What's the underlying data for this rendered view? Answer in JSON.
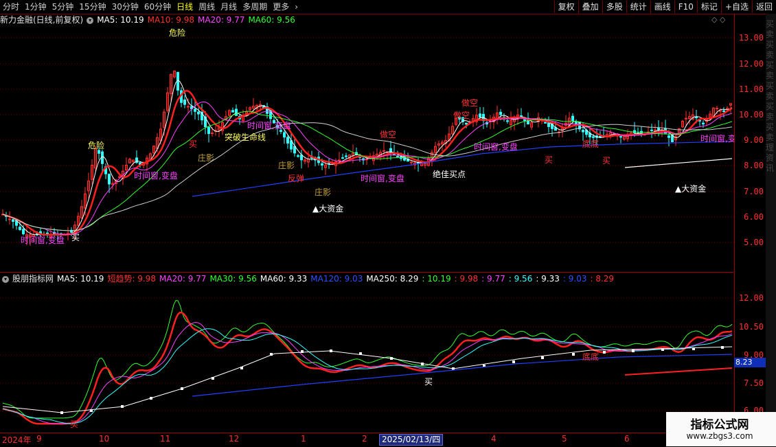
{
  "toolbar": {
    "periods": [
      "分时",
      "1分钟",
      "5分钟",
      "15分钟",
      "30分钟",
      "60分钟",
      "日线",
      "周线",
      "月线",
      "多周期",
      "更多"
    ],
    "active_period": "日线",
    "more_arrow": "›",
    "buttons": [
      "复权",
      "叠加",
      "多股",
      "统计",
      "画线",
      "F10",
      "标记",
      "+自选",
      "返回"
    ]
  },
  "main_panel": {
    "stock_title": "新力金融(日线,前复权)",
    "ma_labels": [
      {
        "text": "MA5: 10.19",
        "color": "#ffffff"
      },
      {
        "text": "MA10: 9.98",
        "color": "#ff3030"
      },
      {
        "text": "MA20: 9.77",
        "color": "#ff40ff"
      },
      {
        "text": "MA60: 9.56",
        "color": "#30ff30"
      }
    ],
    "top_icons": "◇  ◇",
    "y_ticks": [
      "13.00",
      "12.00",
      "11.00",
      "10.00",
      "9.00",
      "8.00",
      "7.00",
      "6.00",
      "5.00"
    ],
    "annotations": [
      "危险",
      "危险",
      "庄影",
      "庄影",
      "庄影",
      "反弹",
      "时间窗,变盘",
      "时间窗,变盘",
      "时间窗,变盘",
      "时间窗,变盘",
      "时间窗,变盘",
      "时间窗,变盘",
      "突破生命线",
      "做空",
      "做空",
      "做空",
      "买",
      "买",
      "买",
      "买",
      "绝佳买点",
      "▲大资金",
      "▲大资金",
      "底底"
    ],
    "right_strip_chars": "买卖买卖买卖买卖买卖买卖理资讯"
  },
  "indicator_panel": {
    "title": "股朋指标网",
    "ma_labels": [
      {
        "text": "MA5: 10.19",
        "color": "#ffffff"
      },
      {
        "text": "短趋势: 9.98",
        "color": "#ff3030"
      },
      {
        "text": "MA20: 9.77",
        "color": "#ff40ff"
      },
      {
        "text": "MA30: 9.56",
        "color": "#30ff30"
      },
      {
        "text": "MA60: 9.33",
        "color": "#ffffff"
      },
      {
        "text": "MA120: 9.03",
        "color": "#3050ff"
      },
      {
        "text": "MA250: 8.29",
        "color": "#ffffff"
      },
      {
        "text": ": 10.19",
        "color": "#30ff30"
      },
      {
        "text": ": 9.98",
        "color": "#ff3030"
      },
      {
        "text": ": 9.77",
        "color": "#ff40ff"
      },
      {
        "text": ": 9.56",
        "color": "#30ffff"
      },
      {
        "text": ": 9.33",
        "color": "#ffffff"
      },
      {
        "text": ": 9.03",
        "color": "#3050ff"
      },
      {
        "text": ": 8.29",
        "color": "#ff3030"
      }
    ],
    "y_ticks": [
      "12.00",
      "10.50",
      "9.00",
      "7.50",
      "6.00"
    ],
    "current_price_tag": "8.23",
    "annotations": [
      "买",
      "买",
      "底底"
    ]
  },
  "x_axis": {
    "labels": [
      "2024年",
      "9",
      "10",
      "11",
      "12",
      "1",
      "2",
      "4",
      "5",
      "6"
    ],
    "cursor_date": "2025/02/13/四"
  },
  "watermark": {
    "line1": "指标公式网",
    "line2": "www.zbgs3.com"
  },
  "colors": {
    "background": "#000000",
    "axis": "#a00000",
    "up": "#ff3030",
    "down": "#30ffff",
    "ma5": "#ffffff",
    "ma10": "#ff2020",
    "ma20": "#ff40ff",
    "ma60": "#30ff30",
    "ma120": "#3050ff"
  }
}
